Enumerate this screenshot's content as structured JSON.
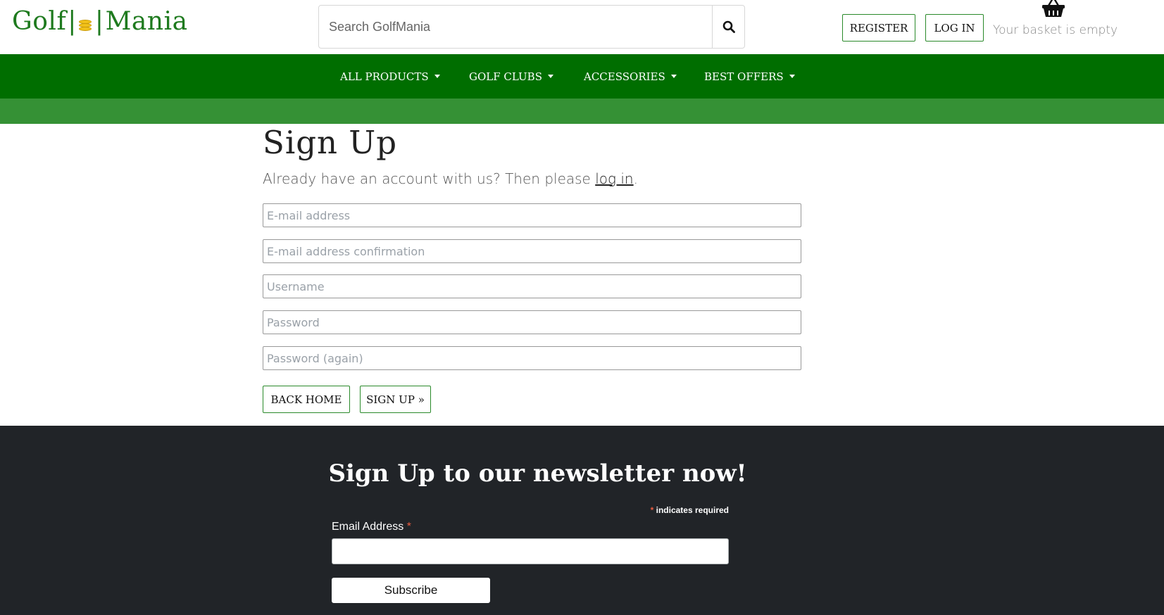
{
  "header": {
    "logo": {
      "left": "Golf",
      "right": "Mania"
    },
    "search": {
      "placeholder": "Search GolfMania"
    },
    "register_label": "REGISTER",
    "login_label": "LOG IN",
    "basket_text": "Your basket is empty"
  },
  "nav": {
    "items": [
      {
        "label": "ALL PRODUCTS"
      },
      {
        "label": "GOLF CLUBS"
      },
      {
        "label": "ACCESSORIES"
      },
      {
        "label": "BEST OFFERS"
      }
    ]
  },
  "main": {
    "title": "Sign Up",
    "subtitle_prefix": "Already have an account with us? Then please ",
    "subtitle_link": "log in",
    "subtitle_suffix": ".",
    "fields": {
      "email": "E-mail address",
      "email_confirm": "E-mail address confirmation",
      "username": "Username",
      "password": "Password",
      "password_again": "Password (again)"
    },
    "back_label": "BACK HOME",
    "signup_label": "SIGN UP »"
  },
  "footer": {
    "title": "Sign Up to our newsletter now!",
    "required_star": "*",
    "required_text": " indicates required",
    "email_label": "Email Address ",
    "email_star": "*",
    "subscribe_label": "Subscribe"
  },
  "colors": {
    "brand_green": "#006e00",
    "light_green": "#359135",
    "footer_bg": "#212428",
    "required_red": "#e85c41"
  }
}
